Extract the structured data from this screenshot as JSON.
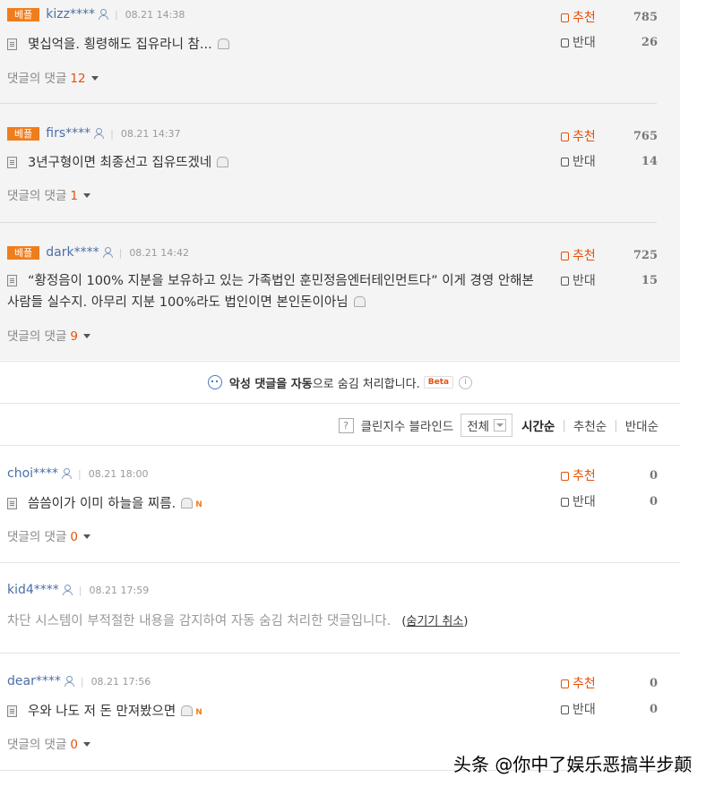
{
  "best_badge": "베플",
  "up_label": "추천",
  "down_label": "반대",
  "reply_label": "댓글의 댓글",
  "comments": [
    {
      "user": "kizz****",
      "date": "08.21 14:38",
      "text": "몇십억을. 횡령해도 집유라니 참...",
      "replies": "12",
      "up": "785",
      "down": "26"
    },
    {
      "user": "firs****",
      "date": "08.21 14:37",
      "text": "3년구형이면 최종선고 집유뜨겠네",
      "replies": "1",
      "up": "765",
      "down": "14"
    },
    {
      "user": "dark****",
      "date": "08.21 14:42",
      "text": "“황정음이 100% 지분을 보유하고 있는 가족법인 훈민정음엔터테인먼트다” 이게 경영 안해본 사람들 실수지. 아무리 지분 100%라도 법인이면 본인돈이아님",
      "replies": "9",
      "up": "725",
      "down": "15"
    },
    {
      "user": "choi****",
      "date": "08.21 18:00",
      "text": "씀씀이가 이미 하늘을 찌름.",
      "replies": "0",
      "up": "0",
      "down": "0"
    },
    {
      "user": "kid4****",
      "date": "08.21 17:59",
      "text": "차단 시스템이 부적절한 내용을 감지하여 자동 숨김 처리한 댓글입니다.",
      "undo": "숨기기 취소"
    },
    {
      "user": "dear****",
      "date": "08.21 17:56",
      "text": "우와 나도 저 돈 만져봤으면",
      "replies": "0",
      "up": "0",
      "down": "0"
    }
  ],
  "notice": {
    "bold": "악성 댓글을 자동",
    "rest": "으로 숨김 처리합니다.",
    "beta": "Beta",
    "info": "i"
  },
  "sortbar": {
    "help": "?",
    "filter_label": "클린지수 블라인드",
    "select_value": "전체",
    "options": [
      "시간순",
      "추천순",
      "반대순"
    ]
  },
  "watermark": "头条 @你中了娱乐恶搞半步颠",
  "colors": {
    "accent": "#e5520a",
    "badge": "#f07d1c",
    "user": "#4b6ea5",
    "best_bg": "#f4f4f4"
  }
}
